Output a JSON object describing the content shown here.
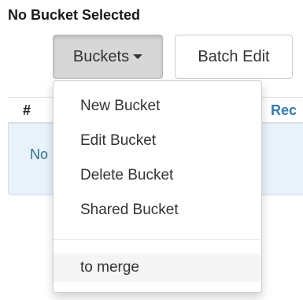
{
  "header": {
    "title": "No Bucket Selected"
  },
  "toolbar": {
    "buckets_label": "Buckets",
    "batch_edit_label": "Batch Edit"
  },
  "table": {
    "columns": [
      "#",
      "Rec"
    ],
    "empty_message": "No"
  },
  "dropdown": {
    "items": [
      {
        "label": "New Bucket"
      },
      {
        "label": "Edit Bucket"
      },
      {
        "label": "Delete Bucket"
      },
      {
        "label": "Shared Bucket"
      }
    ],
    "extra_item": {
      "label": "to merge"
    }
  }
}
